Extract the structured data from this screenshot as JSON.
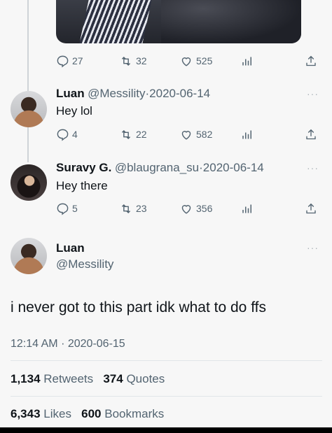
{
  "top_tweet": {
    "actions": {
      "replies": "27",
      "retweets": "32",
      "likes": "525"
    }
  },
  "reply1": {
    "name": "Luan",
    "handle": "@Messility",
    "date": "2020-06-14",
    "text": "Hey lol",
    "actions": {
      "replies": "4",
      "retweets": "22",
      "likes": "582"
    }
  },
  "reply2": {
    "name": "Suravy G.",
    "handle": "@blaugrana_su",
    "date": "2020-06-14",
    "text": "Hey there",
    "actions": {
      "replies": "5",
      "retweets": "23",
      "likes": "356"
    }
  },
  "main": {
    "name": "Luan",
    "handle": "@Messility",
    "text": "i never got to this part idk what to do ffs",
    "time": "12:14 AM",
    "date": "2020-06-15",
    "retweets_count": "1,134",
    "retweets_label": "Retweets",
    "quotes_count": "374",
    "quotes_label": "Quotes",
    "likes_count": "6,343",
    "likes_label": "Likes",
    "bookmarks_count": "600",
    "bookmarks_label": "Bookmarks"
  },
  "separator": "·",
  "more": "···",
  "icons": [
    "reply-icon",
    "retweet-icon",
    "like-icon",
    "analytics-icon",
    "share-icon"
  ],
  "colors": {
    "text": "#0f1419",
    "secondary": "#536471",
    "background": "#f7f7f7"
  }
}
